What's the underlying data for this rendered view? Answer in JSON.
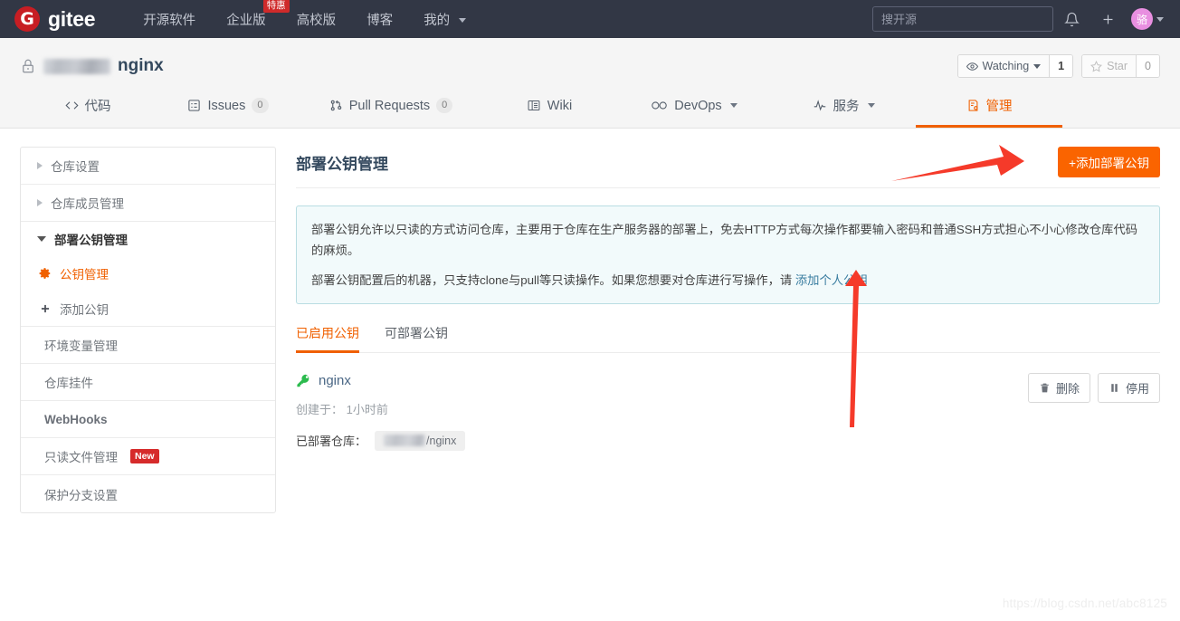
{
  "topnav": {
    "brand": "gitee",
    "logo_letter": "G",
    "items": [
      {
        "label": "开源软件",
        "caret": false,
        "badge": null
      },
      {
        "label": "企业版",
        "caret": false,
        "badge": "特惠"
      },
      {
        "label": "高校版",
        "caret": false,
        "badge": null
      },
      {
        "label": "博客",
        "caret": false,
        "badge": null
      },
      {
        "label": "我的",
        "caret": true,
        "badge": null
      }
    ],
    "search_placeholder": "搜开源",
    "notification_icon": "bell-icon",
    "add_icon": "plus-icon",
    "avatar_letter": "骆"
  },
  "repo": {
    "lock_icon": "lock-icon",
    "owner_redacted": "",
    "name": "nginx",
    "watch": {
      "label": "Watching",
      "count": "1",
      "icon": "eye-icon"
    },
    "star": {
      "label": "Star",
      "count": "0",
      "icon": "star-icon"
    }
  },
  "repo_tabs": [
    {
      "label": "代码",
      "icon": "code-icon",
      "count": null,
      "caret": false,
      "active": false
    },
    {
      "label": "Issues",
      "icon": "issue-icon",
      "count": "0",
      "caret": false,
      "active": false
    },
    {
      "label": "Pull Requests",
      "icon": "pull-request-icon",
      "count": "0",
      "caret": false,
      "active": false
    },
    {
      "label": "Wiki",
      "icon": "wiki-icon",
      "count": null,
      "caret": false,
      "active": false
    },
    {
      "label": "DevOps",
      "icon": "infinity-icon",
      "count": null,
      "caret": true,
      "active": false
    },
    {
      "label": "服务",
      "icon": "pulse-icon",
      "count": null,
      "caret": true,
      "active": false
    },
    {
      "label": "管理",
      "icon": "settings-doc-icon",
      "count": null,
      "caret": false,
      "active": true
    }
  ],
  "sidebar": [
    {
      "label": "仓库设置",
      "type": "collapsible",
      "icon": "triangle-right-icon",
      "active": false,
      "badge": null
    },
    {
      "label": "仓库成员管理",
      "type": "collapsible",
      "icon": "triangle-right-icon",
      "active": false,
      "badge": null
    },
    {
      "label": "部署公钥管理",
      "type": "group",
      "icon": "triangle-down-icon",
      "active": false,
      "badge": null
    },
    {
      "label": "公钥管理",
      "type": "sub",
      "icon": "gear-icon",
      "active": true,
      "badge": null
    },
    {
      "label": "添加公钥",
      "type": "sub",
      "icon": "plus-icon",
      "active": false,
      "badge": null
    },
    {
      "label": "环境变量管理",
      "type": "plain",
      "icon": null,
      "active": false,
      "badge": null
    },
    {
      "label": "仓库挂件",
      "type": "plain",
      "icon": null,
      "active": false,
      "badge": null
    },
    {
      "label": "WebHooks",
      "type": "plain",
      "icon": null,
      "active": false,
      "badge": null
    },
    {
      "label": "只读文件管理",
      "type": "plain",
      "icon": null,
      "active": false,
      "badge": "New"
    },
    {
      "label": "保护分支设置",
      "type": "plain",
      "icon": null,
      "active": false,
      "badge": null
    }
  ],
  "main": {
    "title": "部署公钥管理",
    "add_button": "+添加部署公钥",
    "notice_line1": "部署公钥允许以只读的方式访问仓库，主要用于仓库在生产服务器的部署上，免去HTTP方式每次操作都要输入密码和普通SSH方式担心不小心修改仓库代码的麻烦。",
    "notice_line2_prefix": "部署公钥配置后的机器，只支持clone与pull等只读操作。如果您想要对仓库进行写操作，请 ",
    "notice_link": "添加个人公钥",
    "key_tabs": [
      {
        "label": "已启用公钥",
        "active": true
      },
      {
        "label": "可部署公钥",
        "active": false
      }
    ],
    "key": {
      "icon": "key-icon",
      "name": "nginx",
      "created_label": "创建于：",
      "created_value": "1小时前",
      "deployed_label": "已部署仓库：",
      "deployed_repo_suffix": "/nginx",
      "delete_button": "删除",
      "delete_icon": "trash-icon",
      "disable_button": "停用",
      "disable_icon": "pause-icon"
    }
  },
  "watermark": "https://blog.csdn.net/abc8125"
}
